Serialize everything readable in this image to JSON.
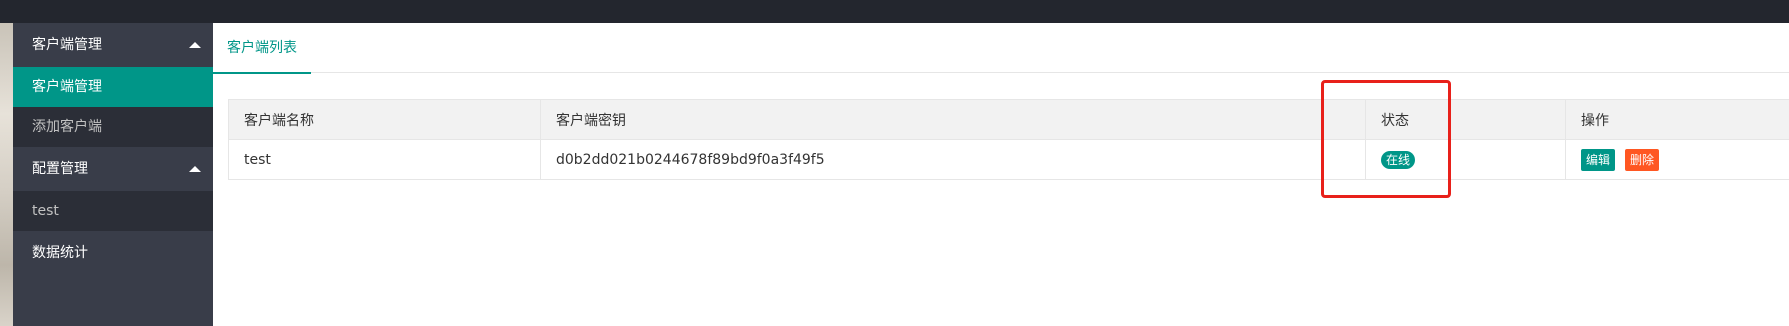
{
  "sidebar": {
    "groups": [
      {
        "label": "客户端管理",
        "items": [
          "客户端管理",
          "添加客户端"
        ]
      },
      {
        "label": "配置管理",
        "items": [
          "test"
        ]
      },
      {
        "label": "数据统计",
        "items": []
      }
    ]
  },
  "main": {
    "tab_label": "客户端列表",
    "table": {
      "headers": [
        "客户端名称",
        "客户端密钥",
        "状态",
        "操作"
      ],
      "rows": [
        {
          "name": "test",
          "secret": "d0b2dd021b0244678f89bd9f0a3f49f5",
          "status": "在线",
          "edit_label": "编辑",
          "delete_label": "删除"
        }
      ]
    }
  },
  "colors": {
    "accent": "#009688",
    "danger": "#ff5722",
    "sidebar_bg": "#393d49",
    "highlight": "#e8201a"
  }
}
